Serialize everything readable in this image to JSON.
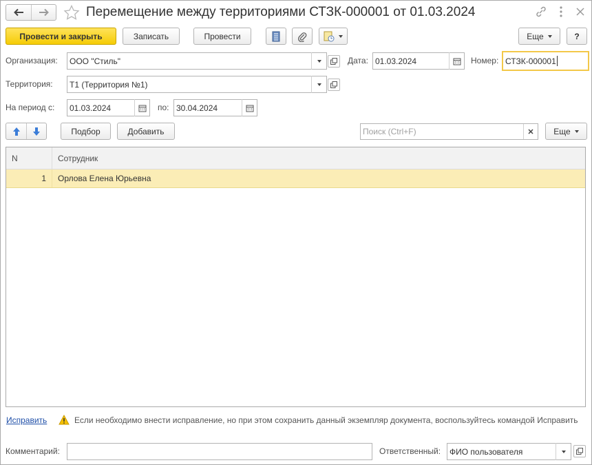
{
  "title": "Перемещение между территориями СТЗК-000001 от 01.03.2024",
  "toolbar": {
    "post_close": "Провести и закрыть",
    "save": "Записать",
    "post": "Провести",
    "more": "Еще",
    "help": "?"
  },
  "fields": {
    "organization_label": "Организация:",
    "organization_value": "ООО \"Стиль\"",
    "date_label": "Дата:",
    "date_value": "01.03.2024",
    "number_label": "Номер:",
    "number_value": "СТЗК-000001",
    "territory_label": "Территория:",
    "territory_value": "Т1 (Территория №1)",
    "period_label": "На период с:",
    "period_from": "01.03.2024",
    "period_to_label": "по:",
    "period_to": "30.04.2024"
  },
  "table_toolbar": {
    "select": "Подбор",
    "add": "Добавить",
    "search_placeholder": "Поиск (Ctrl+F)",
    "more": "Еще"
  },
  "table": {
    "columns": [
      "N",
      "Сотрудник"
    ],
    "rows": [
      {
        "n": "1",
        "employee": "Орлова Елена Юрьевна"
      }
    ]
  },
  "correction": {
    "link": "Исправить",
    "message": "Если необходимо внести исправление, но при этом сохранить данный экземпляр документа, воспользуйтесь командой Исправить"
  },
  "footer": {
    "comment_label": "Комментарий:",
    "comment_value": "",
    "responsible_label": "Ответственный:",
    "responsible_value": "ФИО пользователя"
  },
  "colors": {
    "primary_button": "#f5cc06",
    "selected_row": "#fbedb6",
    "focus_border": "#f3c848",
    "link": "#1f4fa8"
  }
}
